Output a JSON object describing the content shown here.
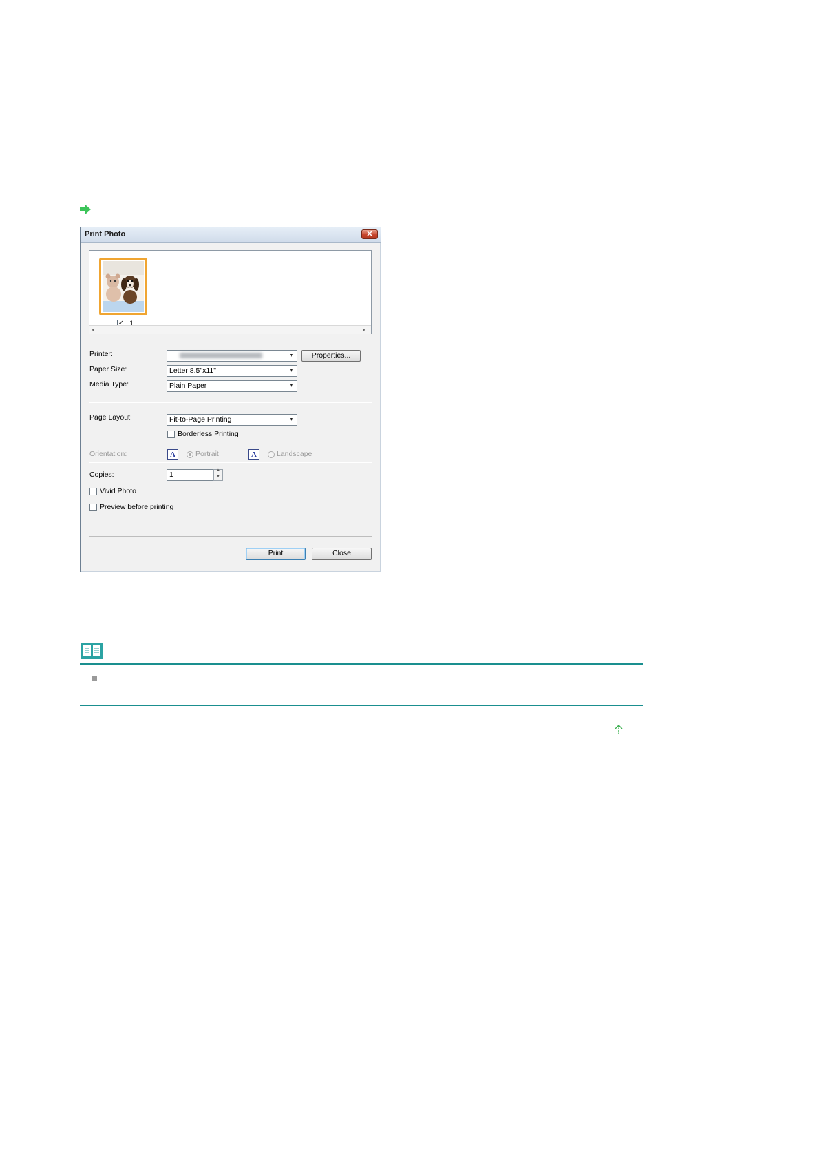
{
  "dialog": {
    "title": "Print Photo",
    "close_glyph": "✕",
    "thumbnail": {
      "check_glyph": "✓",
      "number": "1"
    },
    "scroll": {
      "left_glyph": "◂",
      "right_glyph": "▸"
    },
    "printer": {
      "label": "Printer:",
      "properties_label": "Properties..."
    },
    "paper_size": {
      "label": "Paper Size:",
      "value": "Letter 8.5\"x11\""
    },
    "media_type": {
      "label": "Media Type:",
      "value": "Plain Paper"
    },
    "page_layout": {
      "label": "Page Layout:",
      "value": "Fit-to-Page Printing"
    },
    "borderless": {
      "label": "Borderless Printing",
      "checked": false
    },
    "orientation": {
      "label": "Orientation:",
      "icon_glyph": "A",
      "portrait_label": "Portrait",
      "landscape_label": "Landscape",
      "selected": "Portrait"
    },
    "copies": {
      "label": "Copies:",
      "value": "1"
    },
    "vivid_photo": {
      "label": "Vivid Photo",
      "checked": false
    },
    "preview": {
      "label": "Preview before printing",
      "checked": false
    },
    "print_label": "Print",
    "close_label": "Close"
  },
  "colors": {
    "accent_arrow": "#3cc45a",
    "rule": "#1a8f8f",
    "thumbnail_border": "#f0a531"
  }
}
